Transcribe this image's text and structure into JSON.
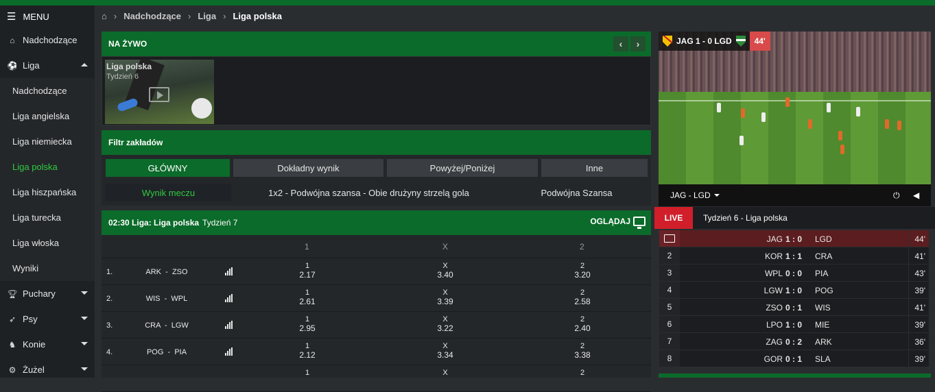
{
  "sidebar": {
    "menu_label": "MENU",
    "items": [
      {
        "label": "Nadchodzące",
        "icon": "home-icon"
      },
      {
        "label": "Liga",
        "icon": "soccer-ball-icon"
      },
      {
        "label": "Puchary",
        "icon": "trophy-icon"
      },
      {
        "label": "Psy",
        "icon": "dog-icon"
      },
      {
        "label": "Konie",
        "icon": "horse-icon"
      },
      {
        "label": "Żużel",
        "icon": "speedway-icon"
      }
    ],
    "sub_items": [
      "Nadchodzące",
      "Liga angielska",
      "Liga niemiecka",
      "Liga polska",
      "Liga hiszpańska",
      "Liga turecka",
      "Liga włoska",
      "Wyniki"
    ]
  },
  "breadcrumb": {
    "items": [
      "Nadchodzące",
      "Liga",
      "Liga polska"
    ]
  },
  "live": {
    "title": "NA ŻYWO",
    "thumb_title": "Liga polska",
    "thumb_sub": "Tydzień 6"
  },
  "filter": {
    "title": "Filtr zakładów",
    "tabs": [
      "GŁÓWNY",
      "Dokładny wynik",
      "Powyżej/Poniżej",
      "Inne"
    ],
    "subs": [
      "Wynik meczu",
      "1x2 - Podwójna szansa - Obie drużyny strzelą gola",
      "Podwójna Szansa"
    ]
  },
  "match": {
    "time_title": "02:30 Liga: Liga polska",
    "week": "Tydzień 7",
    "watch": "OGLĄDAJ",
    "columns": [
      "1",
      "X",
      "2"
    ],
    "rows": [
      {
        "num": "1.",
        "home": "ARK",
        "away": "ZSO",
        "o1": "2.17",
        "ox": "3.40",
        "o2": "3.20"
      },
      {
        "num": "2.",
        "home": "WIS",
        "away": "WPL",
        "o1": "2.61",
        "ox": "3.39",
        "o2": "2.58"
      },
      {
        "num": "3.",
        "home": "CRA",
        "away": "LGW",
        "o1": "2.95",
        "ox": "3.22",
        "o2": "2.40"
      },
      {
        "num": "4.",
        "home": "POG",
        "away": "PIA",
        "o1": "2.12",
        "ox": "3.34",
        "o2": "3.38"
      },
      {
        "num": "",
        "home": "",
        "away": "",
        "o1": "",
        "ox": "",
        "o2": ""
      }
    ],
    "labels": {
      "one": "1",
      "x": "X",
      "two": "2",
      "dash": "-"
    }
  },
  "video": {
    "score": "JAG 1 - 0 LGD",
    "minute": "44'",
    "select": "JAG - LGD"
  },
  "live_results": {
    "badge": "LIVE",
    "title": "Tydzień 6 - Liga polska",
    "rows": [
      {
        "n": "",
        "home": "JAG",
        "score": "1 : 0",
        "away": "LGD",
        "min": "44'"
      },
      {
        "n": "2",
        "home": "KOR",
        "score": "1 : 1",
        "away": "CRA",
        "min": "41'"
      },
      {
        "n": "3",
        "home": "WPL",
        "score": "0 : 0",
        "away": "PIA",
        "min": "43'"
      },
      {
        "n": "4",
        "home": "LGW",
        "score": "1 : 0",
        "away": "POG",
        "min": "39'"
      },
      {
        "n": "5",
        "home": "ZSO",
        "score": "0 : 1",
        "away": "WIS",
        "min": "41'"
      },
      {
        "n": "6",
        "home": "LPO",
        "score": "1 : 0",
        "away": "MIE",
        "min": "39'"
      },
      {
        "n": "7",
        "home": "ZAG",
        "score": "0 : 2",
        "away": "ARK",
        "min": "36'"
      },
      {
        "n": "8",
        "home": "GOR",
        "score": "0 : 1",
        "away": "SLA",
        "min": "39'"
      }
    ]
  },
  "colors": {
    "brand_green": "#0b6b2a",
    "active_green": "#2ecc40",
    "live_red": "#d01f2a",
    "minute_red": "#d94a4a"
  }
}
